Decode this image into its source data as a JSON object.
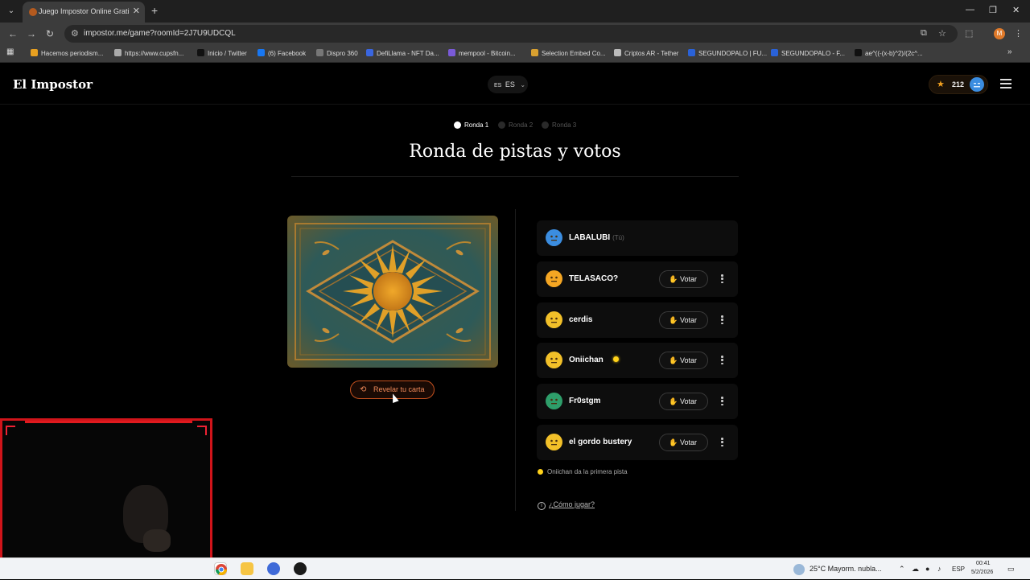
{
  "browser": {
    "tab_title": "Juego Impostor Online Gratis -",
    "url": "impostor.me/game?roomId=2J7U9UDCQL",
    "profile_initial": "M",
    "bookmarks": [
      {
        "label": "Hacemos periodism...",
        "icon": "bookmark-favicon",
        "color": "#e8a020"
      },
      {
        "label": "https://www.cupsfn...",
        "icon": "globe-favicon",
        "color": "#aaaaaa"
      },
      {
        "label": "Inicio / Twitter",
        "icon": "x-favicon",
        "color": "#111111"
      },
      {
        "label": "(6) Facebook",
        "icon": "facebook-favicon",
        "color": "#1877f2"
      },
      {
        "label": "Dispro 360",
        "icon": "chevron-favicon",
        "color": "#777777"
      },
      {
        "label": "DefiLlama - NFT Da...",
        "icon": "defillama-favicon",
        "color": "#3a66e0"
      },
      {
        "label": "mempool - Bitcoin...",
        "icon": "mempool-favicon",
        "color": "#7a5ad8"
      },
      {
        "label": "Selection Embed Co...",
        "icon": "embed-favicon",
        "color": "#d8a030"
      },
      {
        "label": "Criptos AR - Tether",
        "icon": "criptos-favicon",
        "color": "#bbbbbb"
      },
      {
        "label": "SEGUNDOPALO | FU...",
        "icon": "sp-favicon",
        "color": "#2a62d8"
      },
      {
        "label": "SEGUNDOPALO - F...",
        "icon": "sp-favicon",
        "color": "#2a62d8"
      },
      {
        "label": "ae^((-(x-b)^2)/(2c^...",
        "icon": "x-favicon",
        "color": "#111111"
      }
    ]
  },
  "site": {
    "logo": "El Impostor",
    "lang_flag": "ES",
    "lang_code": "ES",
    "score": "212",
    "rounds": [
      "Ronda 1",
      "Ronda 2",
      "Ronda 3"
    ],
    "active_round": "Ronda 1",
    "title": "Ronda de pistas y votos",
    "reveal_label": "Revelar tu carta",
    "players": [
      {
        "name": "LABALUBI",
        "you_tag": "(Tú)",
        "avatar_color": "#3b8de0",
        "can_vote": false,
        "starts": false
      },
      {
        "name": "TELASACO?",
        "you_tag": "",
        "avatar_color": "#f5a623",
        "can_vote": true,
        "starts": false
      },
      {
        "name": "cerdis",
        "you_tag": "",
        "avatar_color": "#f2c029",
        "can_vote": true,
        "starts": false
      },
      {
        "name": "Oniichan",
        "you_tag": "",
        "avatar_color": "#f2c029",
        "can_vote": true,
        "starts": true
      },
      {
        "name": "Fr0stgm",
        "you_tag": "",
        "avatar_color": "#2e9e6a",
        "can_vote": true,
        "starts": false
      },
      {
        "name": "el gordo bustery",
        "you_tag": "",
        "avatar_color": "#f2c029",
        "can_vote": true,
        "starts": false
      }
    ],
    "vote_label": "Votar",
    "hint": "Oniichan da la primera pista",
    "how_to": "¿Cómo jugar?"
  },
  "taskbar": {
    "weather": "25°C  Mayorm. nubla...",
    "lang": "ESP",
    "time": "00:41",
    "date": "5/2/2026"
  }
}
